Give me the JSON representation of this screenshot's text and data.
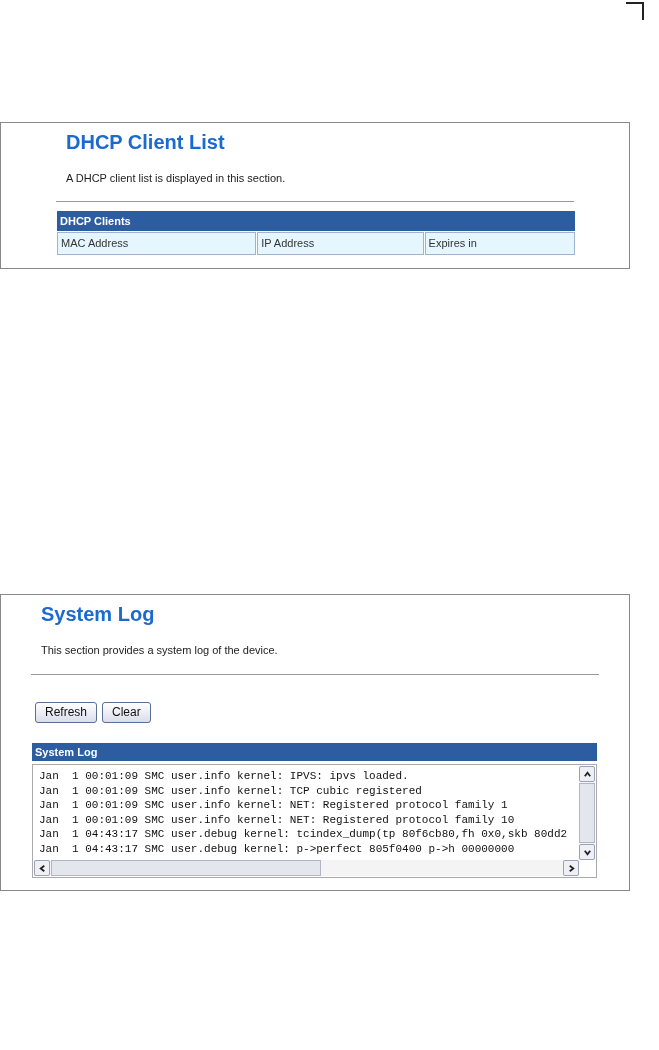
{
  "dhcp_panel": {
    "title": "DHCP Client List",
    "description": "A DHCP client list is displayed in this section.",
    "table": {
      "caption": "DHCP Clients",
      "columns": [
        "MAC Address",
        "IP Address",
        "Expires in"
      ]
    }
  },
  "system_log_panel": {
    "title": "System Log",
    "description": "This section provides a system log of the device.",
    "buttons": [
      "Refresh",
      "Clear"
    ],
    "log": {
      "caption": "System Log",
      "lines": [
        "Jan  1 00:01:09 SMC user.info kernel: IPVS: ipvs loaded.",
        "Jan  1 00:01:09 SMC user.info kernel: TCP cubic registered",
        "Jan  1 00:01:09 SMC user.info kernel: NET: Registered protocol family 1",
        "Jan  1 00:01:09 SMC user.info kernel: NET: Registered protocol family 10",
        "Jan  1 04:43:17 SMC user.debug kernel: tcindex_dump(tp 80f6cb80,fh 0x0,skb 80dd2",
        "Jan  1 04:43:17 SMC user.debug kernel: p->perfect 805f0400 p->h 00000000"
      ]
    }
  }
}
